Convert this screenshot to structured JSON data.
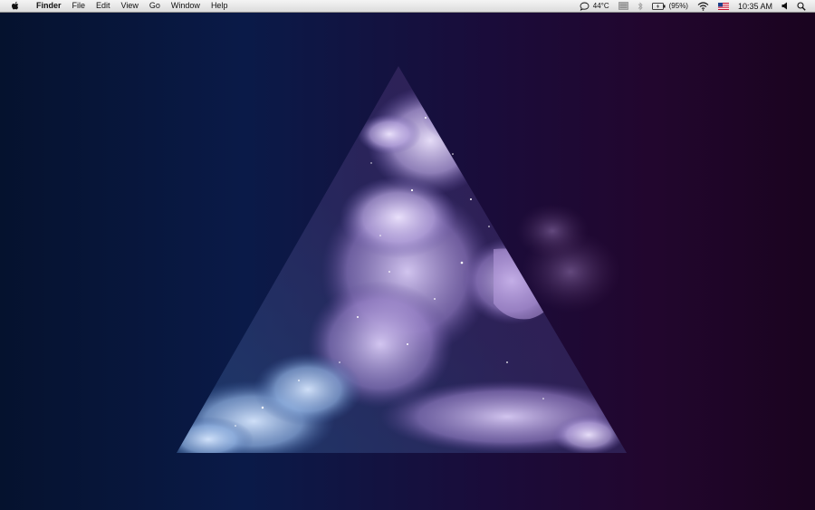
{
  "menubar": {
    "apple_icon": "apple-logo-icon",
    "app_name": "Finder",
    "menus": [
      "File",
      "Edit",
      "View",
      "Go",
      "Window",
      "Help"
    ]
  },
  "status": {
    "temperature": "44°C",
    "battery_percent": "(95%)",
    "time": "10:35 AM",
    "icons": [
      "speech-bubble-icon",
      "menu-extra-icon",
      "bluetooth-icon",
      "battery-icon",
      "wifi-icon",
      "us-flag-icon",
      "volume-icon",
      "spotlight-search-icon"
    ]
  },
  "colors": {
    "menubar_bg": "#e8e8e8",
    "wallpaper_left": "#05122e",
    "wallpaper_right": "#22062e",
    "nebula_light": "#d8c8f0",
    "nebula_blue": "#7fa6d8"
  }
}
